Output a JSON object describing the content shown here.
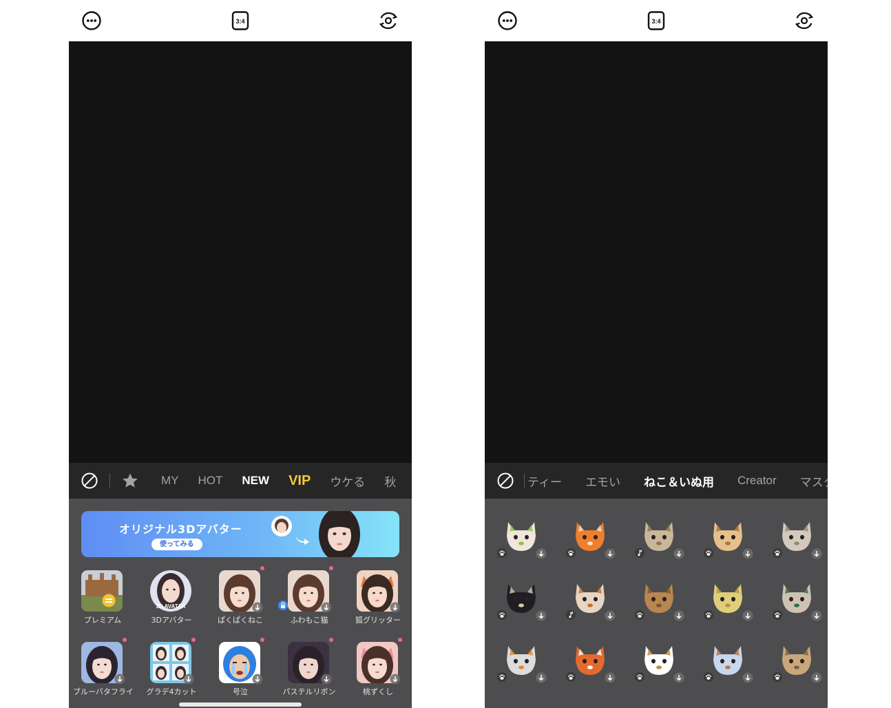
{
  "left": {
    "ratio_label": "3:4",
    "tabs": [
      {
        "label": "MY",
        "style": "normal"
      },
      {
        "label": "HOT",
        "style": "normal"
      },
      {
        "label": "NEW",
        "style": "active"
      },
      {
        "label": "VIP",
        "style": "vip"
      },
      {
        "label": "ウケる",
        "style": "normal"
      },
      {
        "label": "秋",
        "style": "normal"
      }
    ],
    "banner": {
      "title": "オリジナル3Dアバター",
      "button": "使ってみる"
    },
    "filters": [
      {
        "label": "プレミアム",
        "badge": "coin",
        "thumb": "landscape"
      },
      {
        "label": "3Dアバター",
        "badge": "none",
        "thumb": "avatar",
        "thumb_text": "3D AVATAR"
      },
      {
        "label": "ぱくぱくねこ",
        "badge": "download",
        "dot": true,
        "thumb": "face"
      },
      {
        "label": "ふわもこ猫",
        "badge": "download",
        "lock": true,
        "dot": true,
        "thumb": "face"
      },
      {
        "label": "狐グリッター",
        "badge": "download",
        "thumb": "face-fox"
      },
      {
        "label": "ブルーバタフライ",
        "badge": "download",
        "dot": true,
        "thumb": "face-blue"
      },
      {
        "label": "グラデ4カット",
        "badge": "download",
        "dot": true,
        "thumb": "grid4"
      },
      {
        "label": "号泣",
        "badge": "download",
        "dot": true,
        "thumb": "cry"
      },
      {
        "label": "パステルリボン",
        "badge": "download",
        "dot": true,
        "thumb": "face-dark"
      },
      {
        "label": "桃ずくし",
        "badge": "download",
        "dot": true,
        "thumb": "face-peach"
      }
    ]
  },
  "right": {
    "ratio_label": "3:4",
    "tabs": [
      {
        "label": "ティー",
        "style": "normal"
      },
      {
        "label": "エモい",
        "style": "normal"
      },
      {
        "label": "ねこ＆いぬ用",
        "style": "active"
      },
      {
        "label": "Creator",
        "style": "normal"
      },
      {
        "label": "マスク",
        "style": "normal"
      }
    ],
    "stickers": [
      {
        "name": "cat-leaf",
        "bg": "#f2e6dc",
        "accent": "#8bc34a",
        "mark": "paw"
      },
      {
        "name": "pumpkin-cat",
        "bg": "#f07f2c",
        "accent": "#f5e3cf",
        "mark": "paw"
      },
      {
        "name": "cat-dog-duo",
        "bg": "#c9b79a",
        "accent": "#8a7558",
        "mark": "note"
      },
      {
        "name": "toast-cat",
        "bg": "#e6c08b",
        "accent": "#a47446",
        "mark": "paw"
      },
      {
        "name": "cat-dog-glare",
        "bg": "#d4c9bd",
        "accent": "#9a8878",
        "mark": "paw"
      },
      {
        "name": "black-cat",
        "bg": "#1e1e24",
        "accent": "#d6cfa8",
        "mark": "paw"
      },
      {
        "name": "kiss-cat-dog",
        "bg": "#e7d6c3",
        "accent": "#c4702e",
        "mark": "note"
      },
      {
        "name": "lion-dog",
        "bg": "#b8874f",
        "accent": "#7a5530",
        "mark": "paw"
      },
      {
        "name": "burger-dogs",
        "bg": "#e0cf7a",
        "accent": "#b8944a",
        "mark": "paw"
      },
      {
        "name": "latte-pets",
        "bg": "#cfc2b2",
        "accent": "#2f6e4e",
        "mark": "paw"
      },
      {
        "name": "ghost-pumpkin",
        "bg": "#dcdcdc",
        "accent": "#e8862c",
        "mark": "paw"
      },
      {
        "name": "panda-dog",
        "bg": "#e46a2e",
        "accent": "#ffffff",
        "mark": "paw"
      },
      {
        "name": "veggie-dog",
        "bg": "#ffffff",
        "accent": "#c48a4a",
        "mark": "paw"
      },
      {
        "name": "hood-dog",
        "bg": "#c7d7ee",
        "accent": "#b3784a",
        "mark": "paw"
      },
      {
        "name": "paper-bag",
        "bg": "#c9a77a",
        "accent": "#7e6042",
        "mark": "paw"
      }
    ]
  }
}
